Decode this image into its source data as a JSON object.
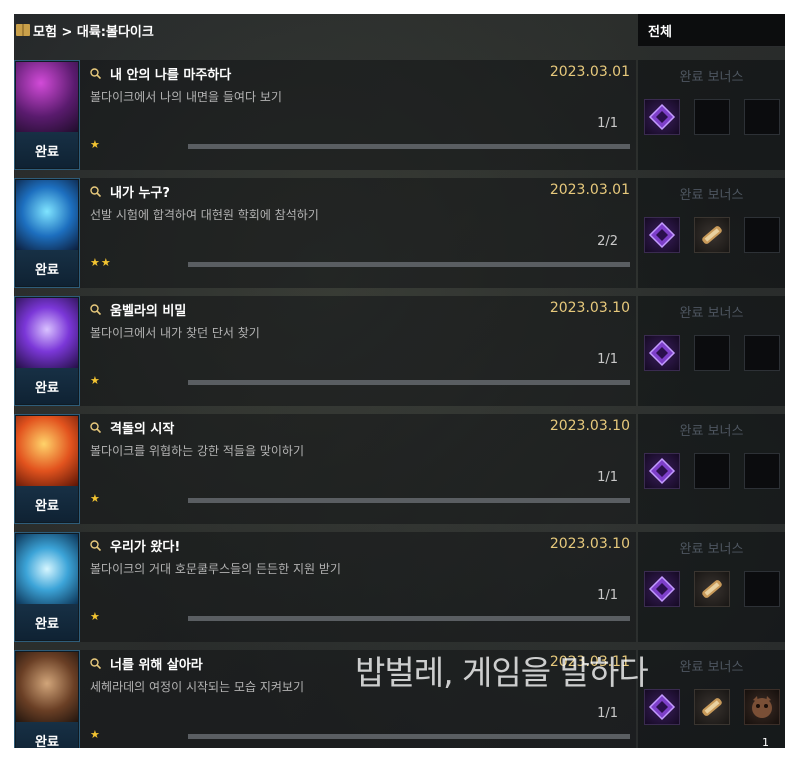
{
  "breadcrumb": {
    "text": "모험 > 대륙:볼다이크"
  },
  "filter": {
    "label": "전체"
  },
  "colors": {
    "date": "#e7c97c",
    "star": "#f3c431",
    "status_bg": "#173045",
    "bonus_label": "#4e5660"
  },
  "quests": [
    {
      "title": "내 안의 나를 마주하다",
      "date": "2023.03.01",
      "description": "볼다이크에서 나의 내면을 들여다 보기",
      "count": "1/1",
      "stars": "★",
      "status": "완료",
      "bonus_label": "완료 보너스",
      "icon": "dark-figure-icon"
    },
    {
      "title": "내가 누구?",
      "date": "2023.03.01",
      "description": "선발 시험에 합격하여 대현원 학회에 참석하기",
      "count": "2/2",
      "stars": "★★",
      "status": "완료",
      "bonus_label": "완료 보너스",
      "icon": "glowing-face-icon"
    },
    {
      "title": "움벨라의 비밀",
      "date": "2023.03.10",
      "description": "볼다이크에서 내가 찾던 단서 찾기",
      "count": "1/1",
      "stars": "★",
      "status": "완료",
      "bonus_label": "완료 보너스",
      "icon": "magic-orb-icon"
    },
    {
      "title": "격돌의 시작",
      "date": "2023.03.10",
      "description": "볼다이크를 위협하는 강한 적들을 맞이하기",
      "count": "1/1",
      "stars": "★",
      "status": "완료",
      "bonus_label": "완료 보너스",
      "icon": "fire-icon"
    },
    {
      "title": "우리가 왔다!",
      "date": "2023.03.10",
      "description": "볼다이크의 거대 호문쿨루스들의 든든한 지원 받기",
      "count": "1/1",
      "stars": "★",
      "status": "완료",
      "bonus_label": "완료 보너스",
      "icon": "golem-icon"
    },
    {
      "title": "너를 위해 살아라",
      "date": "2023.03.11",
      "description": "세헤라데의 여정이 시작되는 모습 지켜보기",
      "count": "1/1",
      "stars": "★",
      "status": "완료",
      "bonus_label": "완료 보너스",
      "icon": "creature-icon"
    }
  ],
  "reward_count": "1",
  "overlay_text": "밥벌레, 게임을 말하다"
}
